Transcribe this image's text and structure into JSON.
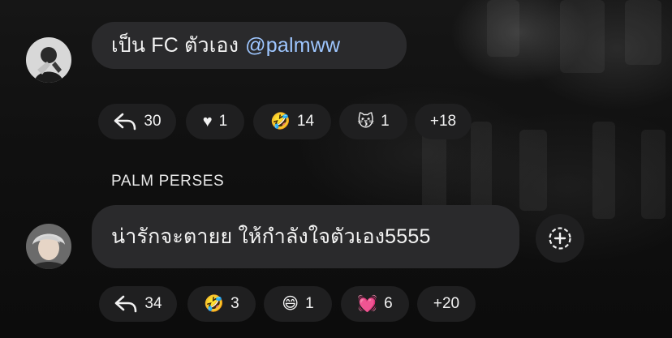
{
  "comments": [
    {
      "text": "เป็น FC ตัวเอง",
      "mention": "@palmww",
      "reactions": [
        {
          "icon": "reply-arrow-icon",
          "count": "30"
        },
        {
          "icon": "heart-icon",
          "emoji": "♥",
          "count": "1"
        },
        {
          "icon": "rolling-laughing-emoji-icon",
          "emoji": "🤣",
          "count": "14"
        },
        {
          "icon": "kissing-cat-emoji-icon",
          "emoji": "😽",
          "count": "1"
        },
        {
          "icon": "more-reactions",
          "count": "+18"
        }
      ]
    },
    {
      "author": "PALM PERSES",
      "text": "น่ารักจะตายย ให้กำลังใจตัวเอง5555",
      "reactions": [
        {
          "icon": "reply-arrow-icon",
          "count": "34"
        },
        {
          "icon": "rolling-laughing-emoji-icon",
          "emoji": "🤣",
          "count": "3"
        },
        {
          "icon": "grinning-emoji-icon",
          "emoji": "😄",
          "count": "1"
        },
        {
          "icon": "growing-heart-emoji-icon",
          "emoji": "💓",
          "count": "6"
        },
        {
          "icon": "more-reactions",
          "count": "+20"
        }
      ]
    }
  ],
  "colors": {
    "bubble": "#2a2a2c",
    "chip": "#1f1f20",
    "mention": "#9ec6ff",
    "text": "#f2f2f2"
  }
}
